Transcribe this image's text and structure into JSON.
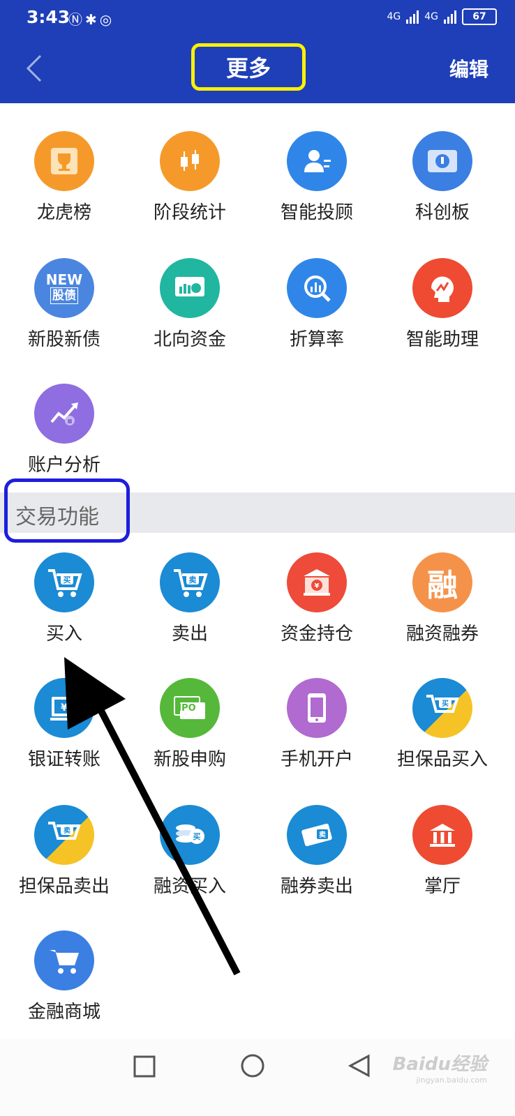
{
  "status": {
    "time": "3:43",
    "battery": "67",
    "network_label": "4G"
  },
  "header": {
    "title": "更多",
    "edit_label": "编辑"
  },
  "more_items": [
    {
      "label": "龙虎榜",
      "icon": "trophy-icon",
      "color": "#f59a2a"
    },
    {
      "label": "阶段统计",
      "icon": "candlestick-icon",
      "color": "#f59a2a"
    },
    {
      "label": "智能投顾",
      "icon": "advisor-icon",
      "color": "#2f86e8"
    },
    {
      "label": "科创板",
      "icon": "science-board-icon",
      "color": "#3b7fe3"
    },
    {
      "label": "新股新债",
      "icon": "new-stock-icon",
      "color": "#4a86e0",
      "badge_top": "NEW",
      "badge_bottom": "股债"
    },
    {
      "label": "北向资金",
      "icon": "northbound-icon",
      "color": "#21b6a0"
    },
    {
      "label": "折算率",
      "icon": "magnifier-chart-icon",
      "color": "#2f86e8"
    },
    {
      "label": "智能助理",
      "icon": "assistant-icon",
      "color": "#ee4b32"
    },
    {
      "label": "账户分析",
      "icon": "account-analysis-icon",
      "color": "#8e6ee0"
    }
  ],
  "section": {
    "title": "交易功能"
  },
  "trade_items": [
    {
      "label": "买入",
      "icon": "buy-cart-icon",
      "color": "#1a8bd4",
      "glyph": "买"
    },
    {
      "label": "卖出",
      "icon": "sell-cart-icon",
      "color": "#1a8bd4",
      "glyph": "卖"
    },
    {
      "label": "资金持仓",
      "icon": "bank-holdings-icon",
      "color": "#ee4b3a",
      "glyph": "¥"
    },
    {
      "label": "融资融券",
      "icon": "margin-icon",
      "color": "#f5924a",
      "glyph": "融"
    },
    {
      "label": "银证转账",
      "icon": "bank-transfer-icon",
      "color": "#1a8bd4",
      "glyph": "¥"
    },
    {
      "label": "新股申购",
      "icon": "ipo-icon",
      "color": "#55b83a",
      "glyph": "IPO"
    },
    {
      "label": "手机开户",
      "icon": "phone-icon",
      "color": "#b06ad0",
      "glyph": ""
    },
    {
      "label": "担保品买入",
      "icon": "collateral-buy-icon",
      "color": "#1a8bd4",
      "glyph": "买"
    },
    {
      "label": "担保品卖出",
      "icon": "collateral-sell-icon",
      "color": "#1a8bd4",
      "glyph": "卖"
    },
    {
      "label": "融资买入",
      "icon": "margin-buy-icon",
      "color": "#1a8bd4",
      "glyph": "买"
    },
    {
      "label": "融券卖出",
      "icon": "short-sell-icon",
      "color": "#1a8bd4",
      "glyph": "卖"
    },
    {
      "label": "掌厅",
      "icon": "hall-icon",
      "color": "#ee4b32",
      "glyph": "🏛"
    },
    {
      "label": "金融商城",
      "icon": "shop-cart-icon",
      "color": "#3b7fe3",
      "glyph": "🛒"
    }
  ],
  "watermark": {
    "brand": "Baidu经验",
    "url": "jingyan.baidu.com"
  }
}
